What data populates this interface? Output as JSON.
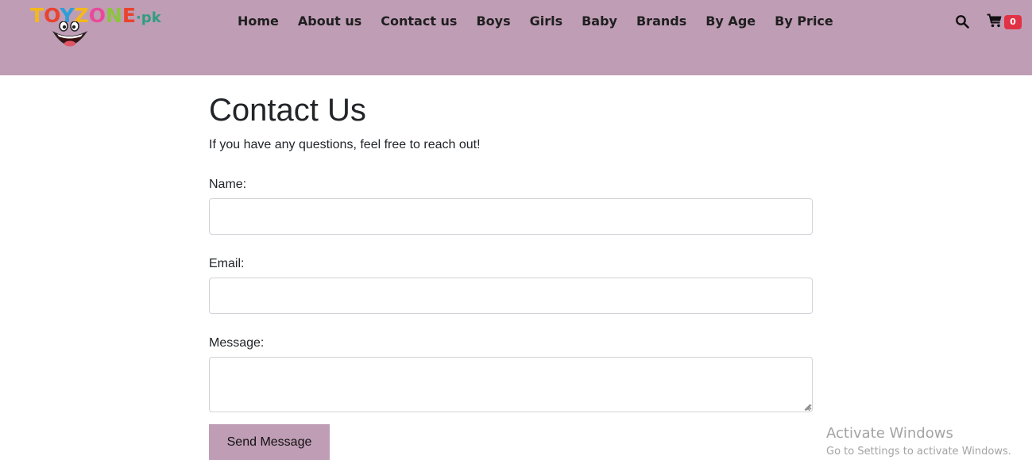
{
  "header": {
    "logo": {
      "letters": [
        "T",
        "O",
        "Y",
        "Z",
        "O",
        "N",
        "E"
      ],
      "suffix": "·pk"
    },
    "nav": [
      {
        "label": "Home"
      },
      {
        "label": "About us"
      },
      {
        "label": "Contact us"
      },
      {
        "label": "Boys"
      },
      {
        "label": "Girls"
      },
      {
        "label": "Baby"
      },
      {
        "label": "Brands"
      },
      {
        "label": "By Age"
      },
      {
        "label": "By Price"
      }
    ],
    "search_icon": "search-icon",
    "cart_icon": "cart-icon",
    "cart_count": "0",
    "colors": {
      "header_bg": "#bf9db5",
      "badge_bg": "#e03244"
    }
  },
  "main": {
    "title": "Contact Us",
    "intro": "If you have any questions, feel free to reach out!",
    "form": {
      "name_label": "Name:",
      "name_value": "",
      "email_label": "Email:",
      "email_value": "",
      "message_label": "Message:",
      "message_value": "",
      "submit_label": "Send Message"
    }
  },
  "watermark": {
    "title": "Activate Windows",
    "subtitle": "Go to Settings to activate Windows."
  }
}
